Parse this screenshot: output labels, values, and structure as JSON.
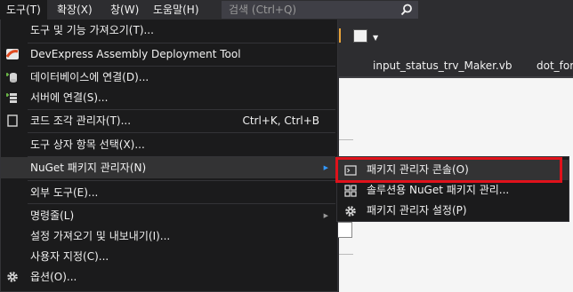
{
  "menubar": {
    "items": [
      {
        "label": "도구(T)",
        "active": true
      },
      {
        "label": "확장(X)",
        "active": false
      },
      {
        "label": "창(W)",
        "active": false
      },
      {
        "label": "도움말(H)",
        "active": false
      }
    ],
    "search_placeholder": "검색 (Ctrl+Q)"
  },
  "tabs": [
    "input_status_trv_Maker.vb",
    "dot_form"
  ],
  "tools_menu": {
    "items": [
      {
        "label": "도구 및 기능 가져오기(T)...",
        "icon": null
      },
      {
        "label": "DevExpress Assembly Deployment Tool",
        "icon": "devexpress-icon"
      },
      {
        "label": "데이터베이스에 연결(D)...",
        "icon": "database-connect-icon"
      },
      {
        "label": "서버에 연결(S)...",
        "icon": "server-connect-icon"
      },
      {
        "label": "코드 조각 관리자(T)...",
        "shortcut": "Ctrl+K, Ctrl+B",
        "icon": "snippet-icon"
      },
      {
        "label": "도구 상자 항목 선택(X)...",
        "icon": null
      },
      {
        "label": "NuGet 패키지 관리자(N)",
        "icon": null,
        "submenu": true
      },
      {
        "label": "외부 도구(E)...",
        "icon": null
      },
      {
        "label": "명령줄(L)",
        "icon": null,
        "submenu": true
      },
      {
        "label": "설정 가져오기 및 내보내기(I)...",
        "icon": null
      },
      {
        "label": "사용자 지정(C)...",
        "icon": null
      },
      {
        "label": "옵션(O)...",
        "icon": "gear-icon"
      }
    ]
  },
  "nuget_submenu": {
    "items": [
      {
        "label": "패키지 관리자 콘솔(O)",
        "icon": "console-icon"
      },
      {
        "label": "솔루션용 NuGet 패키지 관리...",
        "icon": "package-icon"
      },
      {
        "label": "패키지 관리자 설정(P)",
        "icon": "gear-icon"
      }
    ]
  },
  "colors": {
    "menu_bg": "#1b1b1c",
    "highlight": "#333334",
    "callout_red": "#e0121b",
    "accent_blue": "#3399ff"
  }
}
